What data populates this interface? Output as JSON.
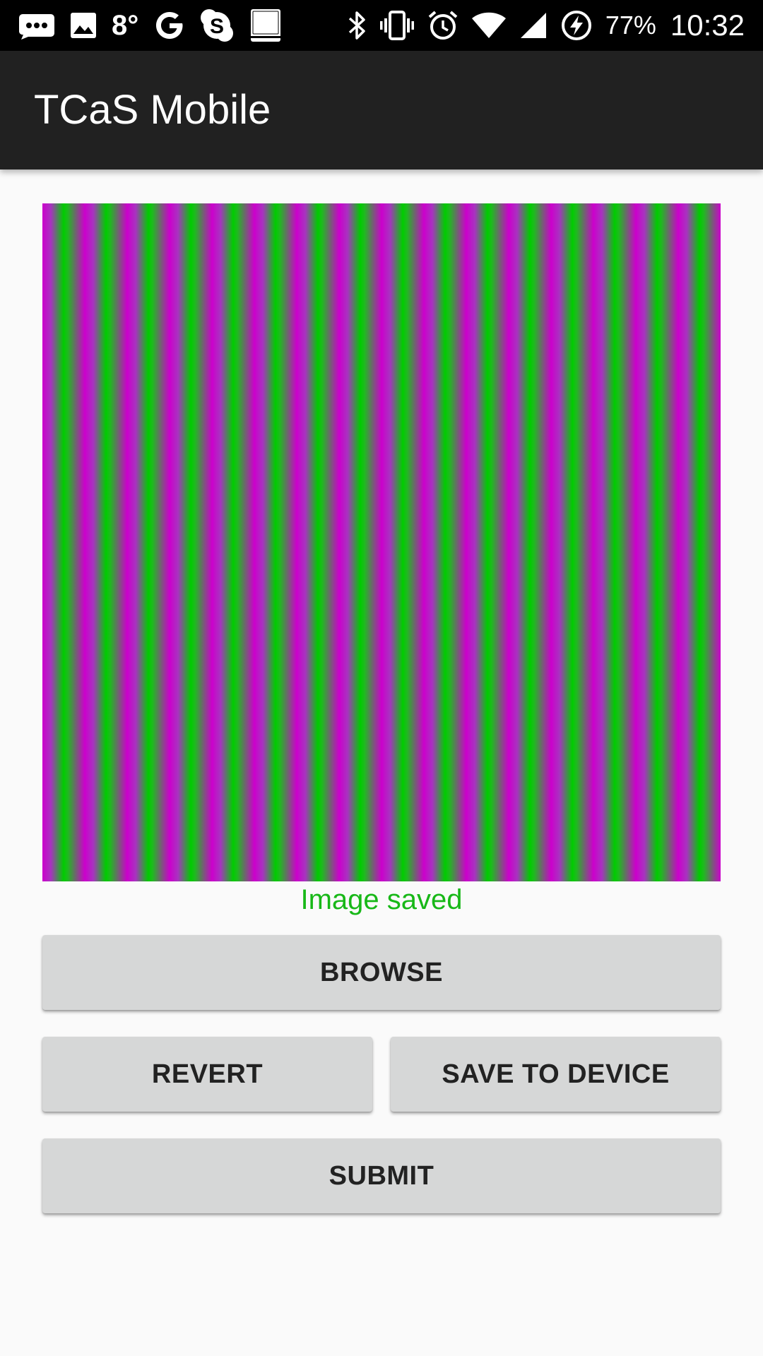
{
  "status_bar": {
    "icons_left": [
      "chat-bubble-icon",
      "image-icon",
      "google-icon",
      "skype-icon",
      "holy-bible-icon"
    ],
    "temperature": "8°",
    "icons_right": [
      "bluetooth-icon",
      "vibrate-icon",
      "alarm-icon",
      "wifi-icon",
      "cell-signal-icon",
      "battery-charging-icon"
    ],
    "battery": "77%",
    "time": "10:32"
  },
  "app_bar": {
    "title": "TCaS Mobile"
  },
  "preview": {
    "stripe_colors": [
      "#cc00cc",
      "#00cc00"
    ]
  },
  "status_message": "Image saved",
  "status_color": "#18b818",
  "buttons": {
    "browse": "BROWSE",
    "revert": "REVERT",
    "save_to_device": "SAVE TO DEVICE",
    "submit": "SUBMIT"
  }
}
